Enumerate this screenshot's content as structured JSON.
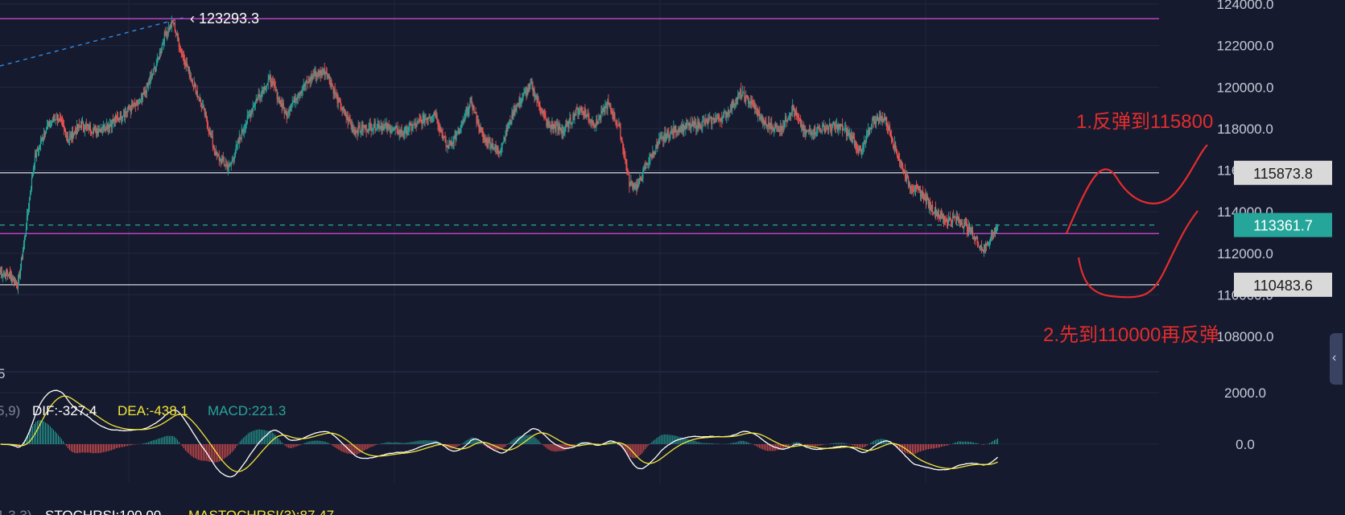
{
  "chart_data": {
    "type": "candlestick",
    "price_axis": {
      "ticks": [
        "124000.0",
        "122000.0",
        "120000.0",
        "118000.0",
        "116000.0",
        "114000.0",
        "112000.0",
        "110000.0",
        "108000.0"
      ],
      "tick_values": [
        124000,
        122000,
        120000,
        118000,
        116000,
        114000,
        112000,
        110000,
        108000
      ]
    },
    "macd_axis": {
      "ticks": [
        "2000.0",
        "0.0"
      ],
      "tick_values": [
        2000,
        0
      ]
    },
    "horizontal_lines": [
      {
        "value": 123293.3,
        "label": "123293.3",
        "color": "#d84bd8",
        "label_style": "inline"
      },
      {
        "value": 115873.8,
        "label": "115873.8",
        "color": "#d9d9d9",
        "label_style": "box"
      },
      {
        "value": 113361.7,
        "label": "113361.7",
        "color": "#26a69a",
        "label_style": "current",
        "dashed": true
      },
      {
        "value": 112950,
        "label": "",
        "color": "#d84bd8",
        "label_style": "none"
      },
      {
        "value": 110483.6,
        "label": "110483.6",
        "color": "#d9d9d9",
        "label_style": "box"
      }
    ],
    "annotations": [
      "1.反弹到115800",
      "2.先到110000再反弹"
    ],
    "indicator_text": {
      "params": "5,9)",
      "dif": "DIF:-327.4",
      "dea": "DEA:-438.1",
      "macd": "MACD:221.3",
      "left_cut": "5",
      "bottom": [
        "1,3,3)",
        "STOCHRSI:100.00",
        "MASTOCHRSI(3):87.47"
      ]
    },
    "keypoints": [
      {
        "i": 0,
        "p": 111100
      },
      {
        "i": 10,
        "p": 111000
      },
      {
        "i": 22,
        "p": 110480
      },
      {
        "i": 32,
        "p": 113300
      },
      {
        "i": 42,
        "p": 116500
      },
      {
        "i": 55,
        "p": 117900
      },
      {
        "i": 70,
        "p": 118600
      },
      {
        "i": 85,
        "p": 117500
      },
      {
        "i": 100,
        "p": 118200
      },
      {
        "i": 118,
        "p": 117900
      },
      {
        "i": 135,
        "p": 118200
      },
      {
        "i": 155,
        "p": 118800
      },
      {
        "i": 175,
        "p": 119300
      },
      {
        "i": 195,
        "p": 121200
      },
      {
        "i": 205,
        "p": 122600
      },
      {
        "i": 215,
        "p": 123100
      },
      {
        "i": 225,
        "p": 121700
      },
      {
        "i": 240,
        "p": 120200
      },
      {
        "i": 255,
        "p": 118600
      },
      {
        "i": 268,
        "p": 116700
      },
      {
        "i": 285,
        "p": 116100
      },
      {
        "i": 300,
        "p": 117800
      },
      {
        "i": 318,
        "p": 119400
      },
      {
        "i": 335,
        "p": 120400
      },
      {
        "i": 355,
        "p": 118700
      },
      {
        "i": 370,
        "p": 119700
      },
      {
        "i": 390,
        "p": 120600
      },
      {
        "i": 405,
        "p": 120800
      },
      {
        "i": 420,
        "p": 119300
      },
      {
        "i": 440,
        "p": 117900
      },
      {
        "i": 470,
        "p": 118200
      },
      {
        "i": 500,
        "p": 117800
      },
      {
        "i": 520,
        "p": 118300
      },
      {
        "i": 540,
        "p": 118800
      },
      {
        "i": 555,
        "p": 117100
      },
      {
        "i": 570,
        "p": 117800
      },
      {
        "i": 585,
        "p": 119300
      },
      {
        "i": 600,
        "p": 117600
      },
      {
        "i": 620,
        "p": 116900
      },
      {
        "i": 640,
        "p": 119000
      },
      {
        "i": 660,
        "p": 120100
      },
      {
        "i": 680,
        "p": 118200
      },
      {
        "i": 700,
        "p": 117900
      },
      {
        "i": 720,
        "p": 119000
      },
      {
        "i": 740,
        "p": 118200
      },
      {
        "i": 755,
        "p": 119200
      },
      {
        "i": 770,
        "p": 118000
      },
      {
        "i": 782,
        "p": 115400
      },
      {
        "i": 792,
        "p": 115200
      },
      {
        "i": 805,
        "p": 116400
      },
      {
        "i": 820,
        "p": 117400
      },
      {
        "i": 840,
        "p": 118000
      },
      {
        "i": 870,
        "p": 118200
      },
      {
        "i": 900,
        "p": 118600
      },
      {
        "i": 920,
        "p": 119700
      },
      {
        "i": 935,
        "p": 119200
      },
      {
        "i": 950,
        "p": 118200
      },
      {
        "i": 970,
        "p": 118000
      },
      {
        "i": 985,
        "p": 119000
      },
      {
        "i": 1000,
        "p": 117800
      },
      {
        "i": 1020,
        "p": 118000
      },
      {
        "i": 1045,
        "p": 118100
      },
      {
        "i": 1060,
        "p": 117500
      },
      {
        "i": 1070,
        "p": 116800
      },
      {
        "i": 1085,
        "p": 118400
      },
      {
        "i": 1100,
        "p": 118500
      },
      {
        "i": 1115,
        "p": 116800
      },
      {
        "i": 1130,
        "p": 115300
      },
      {
        "i": 1145,
        "p": 114900
      },
      {
        "i": 1160,
        "p": 114100
      },
      {
        "i": 1175,
        "p": 113600
      },
      {
        "i": 1190,
        "p": 113700
      },
      {
        "i": 1205,
        "p": 113100
      },
      {
        "i": 1222,
        "p": 112200
      },
      {
        "i": 1230,
        "p": 112700
      },
      {
        "i": 1240,
        "p": 113360
      }
    ]
  }
}
